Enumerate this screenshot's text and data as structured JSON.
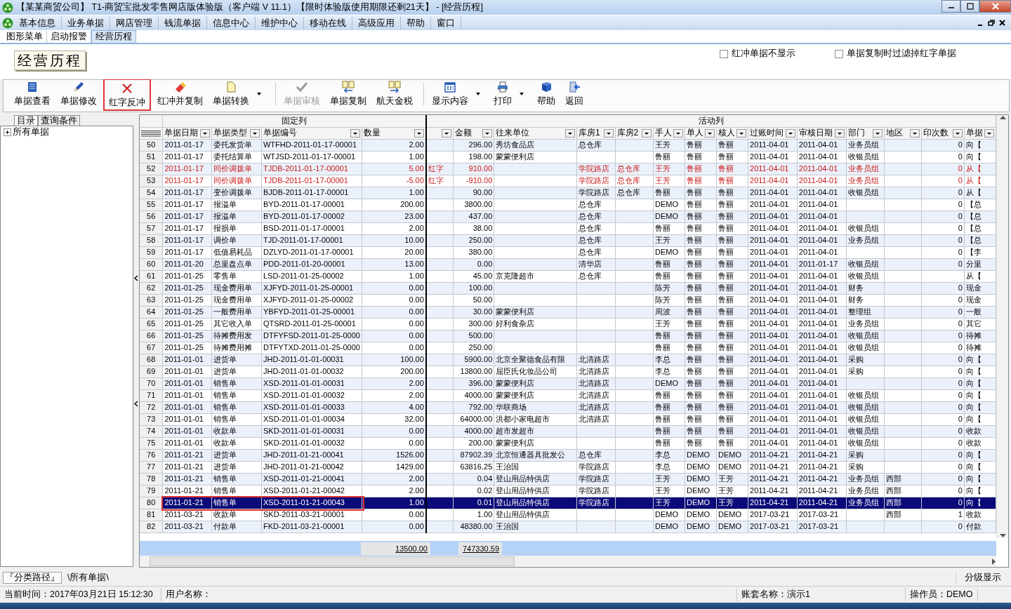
{
  "window": {
    "title": "【某某商贸公司】 T1-商贸宝批发零售网店版体验版（客户端 V 11.1）【限时体验版使用期限还剩21天】 - [经营历程]"
  },
  "menu": [
    "基本信息",
    "业务单据",
    "网店管理",
    "钱流单据",
    "信息中心",
    "维护中心",
    "移动在线",
    "高级应用",
    "帮助",
    "窗口"
  ],
  "tabs": [
    {
      "label": "图形菜单",
      "selected": false
    },
    {
      "label": "启动报警",
      "selected": false
    },
    {
      "label": "经营历程",
      "selected": true
    }
  ],
  "heading": "经营历程",
  "options": [
    {
      "label": "红冲单据不显示",
      "checked": false
    },
    {
      "label": "单据复制时过滤掉红字单据",
      "checked": false
    }
  ],
  "toolbar": [
    {
      "kind": "button",
      "label": "单据查看",
      "disabled": false,
      "marked": false
    },
    {
      "kind": "button",
      "label": "单据修改",
      "disabled": false,
      "marked": false
    },
    {
      "kind": "button",
      "label": "红字反冲",
      "disabled": false,
      "marked": true
    },
    {
      "kind": "button",
      "label": "红冲并复制",
      "disabled": false,
      "marked": false
    },
    {
      "kind": "dropdown",
      "label": "单据转换",
      "disabled": false,
      "marked": false
    },
    {
      "kind": "separator"
    },
    {
      "kind": "button",
      "label": "单据审核",
      "disabled": true,
      "marked": false
    },
    {
      "kind": "button",
      "label": "单据复制",
      "disabled": false,
      "marked": false
    },
    {
      "kind": "button",
      "label": "航天金税",
      "disabled": false,
      "marked": false
    },
    {
      "kind": "separator"
    },
    {
      "kind": "dropdown",
      "label": "显示内容",
      "disabled": false,
      "marked": false
    },
    {
      "kind": "dropdown",
      "label": "打印",
      "disabled": false,
      "marked": false
    },
    {
      "kind": "button",
      "label": "帮助",
      "disabled": false,
      "marked": false
    },
    {
      "kind": "button",
      "label": "返回",
      "disabled": false,
      "marked": false
    }
  ],
  "side_tabs": [
    {
      "label": "目录",
      "selected": true
    },
    {
      "label": "查询条件",
      "selected": false
    }
  ],
  "tree": [
    {
      "label": "所有单据",
      "expanded": false
    }
  ],
  "table": {
    "column_groups": [
      {
        "label": "固定列",
        "columns": [
          {
            "label": "单据日期"
          },
          {
            "label": "单据类型"
          },
          {
            "label": "单据编号"
          },
          {
            "label": "数量"
          }
        ]
      },
      {
        "label": "活动列",
        "columns": [
          {},
          {
            "label": "金额"
          },
          {
            "label": "往来单位"
          },
          {
            "label": "库房1"
          },
          {
            "label": "库房2"
          },
          {
            "label": "手人"
          },
          {
            "label": "单人"
          },
          {
            "label": "核人"
          },
          {
            "label": "过账时间"
          },
          {
            "label": "审核日期"
          },
          {
            "label": "部门"
          },
          {
            "label": "地区"
          },
          {
            "label": "印次数"
          },
          {
            "label": "单据"
          }
        ]
      }
    ],
    "rows": [
      {
        "number": "50",
        "red": false,
        "selected": false,
        "marked": false,
        "cells": [
          "2011-01-17",
          "委托发货单",
          "WTFHD-2011-01-17-00001",
          "2.00",
          null,
          "296.00",
          "秀坊食品店",
          "总仓库",
          null,
          "王芳",
          "鲁丽",
          "鲁丽",
          "2011-04-01",
          "2011-04-01",
          "业务员组",
          null,
          "0",
          "向【"
        ]
      },
      {
        "number": "51",
        "red": false,
        "selected": false,
        "marked": false,
        "cells": [
          "2011-01-17",
          "委托结算单",
          "WTJSD-2011-01-17-00001",
          "1.00",
          null,
          "198.00",
          "蒙蒙便利店",
          null,
          null,
          "鲁丽",
          "鲁丽",
          "鲁丽",
          "2011-04-01",
          "2011-04-01",
          "收银员组",
          null,
          "0",
          "向【"
        ]
      },
      {
        "number": "52",
        "red": true,
        "selected": false,
        "marked": false,
        "cells": [
          "2011-01-17",
          "同价调拨单",
          "TJDB-2011-01-17-00001",
          "5.00",
          "红字",
          "910.00",
          null,
          "学院路店",
          "总仓库",
          "王芳",
          "鲁丽",
          "鲁丽",
          "2011-04-01",
          "2011-04-01",
          "业务员组",
          null,
          "0",
          "从【"
        ]
      },
      {
        "number": "53",
        "red": true,
        "selected": false,
        "marked": false,
        "cells": [
          "2011-01-17",
          "同价调拨单",
          "TJDB-2011-01-17-00001",
          "-5.00",
          "红字",
          "-910.00",
          null,
          "学院路店",
          "总仓库",
          "王芳",
          "鲁丽",
          "鲁丽",
          "2011-04-01",
          "2011-04-01",
          "业务员组",
          null,
          "0",
          "从【"
        ]
      },
      {
        "number": "54",
        "red": false,
        "selected": false,
        "marked": false,
        "cells": [
          "2011-01-17",
          "变价调拨单",
          "BJDB-2011-01-17-00001",
          "1.00",
          null,
          "90.00",
          null,
          "学院路店",
          "总仓库",
          "鲁丽",
          "鲁丽",
          "鲁丽",
          "2011-04-01",
          "2011-04-01",
          "收银员组",
          null,
          "0",
          "从【"
        ]
      },
      {
        "number": "55",
        "red": false,
        "selected": false,
        "marked": false,
        "cells": [
          "2011-01-17",
          "报溢单",
          "BYD-2011-01-17-00001",
          "200.00",
          null,
          "3800.00",
          null,
          "总仓库",
          null,
          "DEMO",
          "鲁丽",
          "鲁丽",
          "2011-04-01",
          "2011-04-01",
          null,
          null,
          "0",
          "【总"
        ]
      },
      {
        "number": "56",
        "red": false,
        "selected": false,
        "marked": false,
        "cells": [
          "2011-01-17",
          "报溢单",
          "BYD-2011-01-17-00002",
          "23.00",
          null,
          "437.00",
          null,
          "总仓库",
          null,
          "DEMO",
          "鲁丽",
          "鲁丽",
          "2011-04-01",
          "2011-04-01",
          null,
          null,
          "0",
          "【总"
        ]
      },
      {
        "number": "57",
        "red": false,
        "selected": false,
        "marked": false,
        "cells": [
          "2011-01-17",
          "报损单",
          "BSD-2011-01-17-00001",
          "2.00",
          null,
          "38.00",
          null,
          "总仓库",
          null,
          "鲁丽",
          "鲁丽",
          "鲁丽",
          "2011-04-01",
          "2011-04-01",
          "收银员组",
          null,
          "0",
          "【总"
        ]
      },
      {
        "number": "58",
        "red": false,
        "selected": false,
        "marked": false,
        "cells": [
          "2011-01-17",
          "调价单",
          "TJD-2011-01-17-00001",
          "10.00",
          null,
          "250.00",
          null,
          "总仓库",
          null,
          "王芳",
          "鲁丽",
          "鲁丽",
          "2011-04-01",
          "2011-04-01",
          "业务员组",
          null,
          "0",
          "【总"
        ]
      },
      {
        "number": "59",
        "red": false,
        "selected": false,
        "marked": false,
        "cells": [
          "2011-01-17",
          "低值易耗品",
          "DZLYD-2011-01-17-00001",
          "20.00",
          null,
          "380.00",
          null,
          "总仓库",
          null,
          "DEMO",
          "鲁丽",
          "鲁丽",
          "2011-04-01",
          "2011-04-01",
          null,
          null,
          "0",
          "【李"
        ]
      },
      {
        "number": "60",
        "red": false,
        "selected": false,
        "marked": false,
        "cells": [
          "2011-01-20",
          "总里盘点单",
          "PDD-2011-01-20-00001",
          "13.00",
          null,
          "0.00",
          null,
          "清华店",
          null,
          "鲁丽",
          "鲁丽",
          "鲁丽",
          "2011-04-01",
          "2011-01-17",
          "收银员组",
          null,
          "0",
          "分里"
        ]
      },
      {
        "number": "61",
        "red": false,
        "selected": false,
        "marked": false,
        "cells": [
          "2011-01-25",
          "零售单",
          "LSD-2011-01-25-00002",
          "1.00",
          null,
          "45.00",
          "京克隆超市",
          "总仓库",
          null,
          "鲁丽",
          "鲁丽",
          "鲁丽",
          "2011-04-01",
          "2011-04-01",
          "收银员组",
          null,
          null,
          "从【"
        ]
      },
      {
        "number": "62",
        "red": false,
        "selected": false,
        "marked": false,
        "cells": [
          "2011-01-25",
          "现金费用单",
          "XJFYD-2011-01-25-00001",
          "0.00",
          null,
          "100.00",
          null,
          null,
          null,
          "陈芳",
          "鲁丽",
          "鲁丽",
          "2011-04-01",
          "2011-04-01",
          "财务",
          null,
          "0",
          "现金"
        ]
      },
      {
        "number": "63",
        "red": false,
        "selected": false,
        "marked": false,
        "cells": [
          "2011-01-25",
          "现金费用单",
          "XJFYD-2011-01-25-00002",
          "0.00",
          null,
          "50.00",
          null,
          null,
          null,
          "陈芳",
          "鲁丽",
          "鲁丽",
          "2011-04-01",
          "2011-04-01",
          "财务",
          null,
          "0",
          "现金"
        ]
      },
      {
        "number": "64",
        "red": false,
        "selected": false,
        "marked": false,
        "cells": [
          "2011-01-25",
          "一般费用单",
          "YBFYD-2011-01-25-00001",
          "0.00",
          null,
          "30.00",
          "蒙蒙便利店",
          null,
          null,
          "周波",
          "鲁丽",
          "鲁丽",
          "2011-04-01",
          "2011-04-01",
          "整理组",
          null,
          "0",
          "一般"
        ]
      },
      {
        "number": "65",
        "red": false,
        "selected": false,
        "marked": false,
        "cells": [
          "2011-01-25",
          "其它收入单",
          "QTSRD-2011-01-25-00001",
          "0.00",
          null,
          "300.00",
          "好利食杂店",
          null,
          null,
          "王芳",
          "鲁丽",
          "鲁丽",
          "2011-04-01",
          "2011-04-01",
          "业务员组",
          null,
          "0",
          "其它"
        ]
      },
      {
        "number": "66",
        "red": false,
        "selected": false,
        "marked": false,
        "cells": [
          "2011-01-25",
          "待摊费用发",
          "DTFYFSD-2011-01-25-0000",
          "0.00",
          null,
          "500.00",
          null,
          null,
          null,
          "鲁丽",
          "鲁丽",
          "鲁丽",
          "2011-04-01",
          "2011-04-01",
          "收银员组",
          null,
          "0",
          "待摊"
        ]
      },
      {
        "number": "67",
        "red": false,
        "selected": false,
        "marked": false,
        "cells": [
          "2011-01-25",
          "待摊费用摊",
          "DTFYTXD-2011-01-25-0000",
          "0.00",
          null,
          "250.00",
          null,
          null,
          null,
          "鲁丽",
          "鲁丽",
          "鲁丽",
          "2011-04-01",
          "2011-04-01",
          "收银员组",
          null,
          "0",
          "待摊"
        ]
      },
      {
        "number": "68",
        "red": false,
        "selected": false,
        "marked": false,
        "cells": [
          "2011-01-01",
          "进货单",
          "JHD-2011-01-01-00031",
          "100.00",
          null,
          "5900.00",
          "北京全聚德食品有限",
          "北清路店",
          null,
          "李总",
          "鲁丽",
          "鲁丽",
          "2011-04-01",
          "2011-04-01",
          "采购",
          null,
          "0",
          "向【"
        ]
      },
      {
        "number": "69",
        "red": false,
        "selected": false,
        "marked": false,
        "cells": [
          "2011-01-01",
          "进货单",
          "JHD-2011-01-01-00032",
          "200.00",
          null,
          "13800.00",
          "屈臣氏化妆品公司",
          "北清路店",
          null,
          "李总",
          "鲁丽",
          "鲁丽",
          "2011-04-01",
          "2011-04-01",
          "采购",
          null,
          "0",
          "向【"
        ]
      },
      {
        "number": "70",
        "red": false,
        "selected": false,
        "marked": false,
        "cells": [
          "2011-01-01",
          "销售单",
          "XSD-2011-01-01-00031",
          "2.00",
          null,
          "396.00",
          "蒙蒙便利店",
          "北清路店",
          null,
          "DEMO",
          "鲁丽",
          "鲁丽",
          "2011-04-01",
          "2011-04-01",
          null,
          null,
          "0",
          "向【"
        ]
      },
      {
        "number": "71",
        "red": false,
        "selected": false,
        "marked": false,
        "cells": [
          "2011-01-01",
          "销售单",
          "XSD-2011-01-01-00032",
          "2.00",
          null,
          "4000.00",
          "蒙蒙便利店",
          "北清路店",
          null,
          "鲁丽",
          "鲁丽",
          "鲁丽",
          "2011-04-01",
          "2011-04-01",
          "收银员组",
          null,
          "0",
          "向【"
        ]
      },
      {
        "number": "72",
        "red": false,
        "selected": false,
        "marked": false,
        "cells": [
          "2011-01-01",
          "销售单",
          "XSD-2011-01-01-00033",
          "4.00",
          null,
          "792.00",
          "华联商场",
          "北清路店",
          null,
          "鲁丽",
          "鲁丽",
          "鲁丽",
          "2011-04-01",
          "2011-04-01",
          "收银员组",
          null,
          "0",
          "向【"
        ]
      },
      {
        "number": "73",
        "red": false,
        "selected": false,
        "marked": false,
        "cells": [
          "2011-01-01",
          "销售单",
          "XSD-2011-01-01-00034",
          "32.00",
          null,
          "64000.00",
          "洪都小家电超市",
          "北清路店",
          null,
          "鲁丽",
          "鲁丽",
          "鲁丽",
          "2011-04-01",
          "2011-04-01",
          "收银员组",
          null,
          "0",
          "向【"
        ]
      },
      {
        "number": "74",
        "red": false,
        "selected": false,
        "marked": false,
        "cells": [
          "2011-01-01",
          "收款单",
          "SKD-2011-01-01-00031",
          "0.00",
          null,
          "4000.00",
          "超市发超市",
          null,
          null,
          "鲁丽",
          "鲁丽",
          "鲁丽",
          "2011-04-01",
          "2011-04-01",
          "收银员组",
          null,
          "0",
          "收款"
        ]
      },
      {
        "number": "75",
        "red": false,
        "selected": false,
        "marked": false,
        "cells": [
          "2011-01-01",
          "收款单",
          "SKD-2011-01-01-00032",
          "0.00",
          null,
          "200.00",
          "蒙蒙便利店",
          null,
          null,
          "鲁丽",
          "鲁丽",
          "鲁丽",
          "2011-04-01",
          "2011-04-01",
          "收银员组",
          null,
          "0",
          "收款"
        ]
      },
      {
        "number": "76",
        "red": false,
        "selected": false,
        "marked": false,
        "cells": [
          "2011-01-21",
          "进货单",
          "JHD-2011-01-21-00041",
          "1526.00",
          null,
          "87902.39",
          "北京恒通器具批发公",
          "总仓库",
          null,
          "李总",
          "DEMO",
          "DEMO",
          "2011-04-21",
          "2011-04-21",
          "采购",
          null,
          "0",
          "向【"
        ]
      },
      {
        "number": "77",
        "red": false,
        "selected": false,
        "marked": false,
        "cells": [
          "2011-01-21",
          "进货单",
          "JHD-2011-01-21-00042",
          "1429.00",
          null,
          "63816.25",
          "王治国",
          "学院路店",
          null,
          "李总",
          "DEMO",
          "DEMO",
          "2011-04-21",
          "2011-04-21",
          "采购",
          null,
          "0",
          "向【"
        ]
      },
      {
        "number": "78",
        "red": false,
        "selected": false,
        "marked": false,
        "cells": [
          "2011-01-21",
          "销售单",
          "XSD-2011-01-21-00041",
          "2.00",
          null,
          "0.04",
          "登山用品特供店",
          "学院路店",
          null,
          "王芳",
          "DEMO",
          "王芳",
          "2011-04-21",
          "2011-04-21",
          "业务员组",
          "西部",
          "0",
          "向【"
        ]
      },
      {
        "number": "79",
        "red": false,
        "selected": false,
        "marked": false,
        "cells": [
          "2011-01-21",
          "销售单",
          "XSD-2011-01-21-00042",
          "2.00",
          null,
          "0.02",
          "登山用品特供店",
          "学院路店",
          null,
          "王芳",
          "DEMO",
          "王芳",
          "2011-04-21",
          "2011-04-21",
          "业务员组",
          "西部",
          "0",
          "向【"
        ]
      },
      {
        "number": "80",
        "red": false,
        "selected": true,
        "marked": true,
        "cells": [
          "2011-01-21",
          "销售单",
          "XSD-2011-01-21-00043",
          "1.00",
          null,
          "0.01",
          "登山用品特供店",
          "学院路店",
          null,
          "王芳",
          "DEMO",
          "王芳",
          "2011-04-21",
          "2011-04-21",
          "业务员组",
          "西部",
          "0",
          "向【"
        ]
      },
      {
        "number": "81",
        "red": false,
        "selected": false,
        "marked": false,
        "cells": [
          "2011-03-21",
          "收款单",
          "SKD-2011-03-21-00001",
          "0.00",
          null,
          "1.00",
          "登山用品特供店",
          null,
          null,
          "DEMO",
          "DEMO",
          "DEMO",
          "2017-03-21",
          "2017-03-21",
          null,
          "西部",
          "1",
          "收款"
        ]
      },
      {
        "number": "82",
        "red": false,
        "selected": false,
        "marked": false,
        "cells": [
          "2011-03-21",
          "付款单",
          "FKD-2011-03-21-00001",
          "0.00",
          null,
          "48380.00",
          "王治国",
          null,
          null,
          "DEMO",
          "DEMO",
          "DEMO",
          "2017-03-21",
          "2017-03-21",
          null,
          null,
          "0",
          "付款"
        ]
      }
    ],
    "totals": {
      "quantity": "13500.00",
      "amount": "747330.59"
    }
  },
  "path_bar": {
    "label": "『分类路径』",
    "path": "\\所有单据\\",
    "right": "分级显示"
  },
  "status_bar": {
    "time": "当前时间：2017年03月21日 15:12:30",
    "user": "用户名称：",
    "account": "账套名称：演示1",
    "operator": "操作员：DEMO"
  }
}
